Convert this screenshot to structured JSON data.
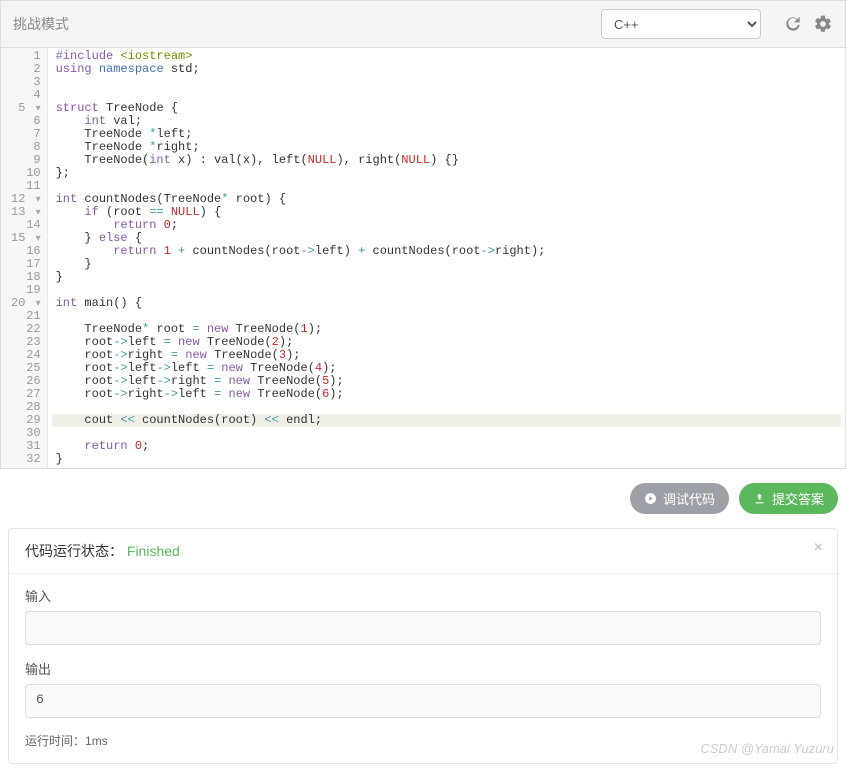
{
  "toolbar": {
    "title": "挑战模式",
    "language": "C++"
  },
  "code": {
    "lines": [
      {
        "n": 1,
        "fold": "",
        "tokens": [
          {
            "t": "#include ",
            "c": "kw"
          },
          {
            "t": "<iostream>",
            "c": "str"
          }
        ]
      },
      {
        "n": 2,
        "fold": "",
        "tokens": [
          {
            "t": "using ",
            "c": "kw"
          },
          {
            "t": "namespace ",
            "c": "ns"
          },
          {
            "t": "std;",
            "c": "ident"
          }
        ]
      },
      {
        "n": 3,
        "fold": "",
        "tokens": []
      },
      {
        "n": 4,
        "fold": "",
        "tokens": []
      },
      {
        "n": 5,
        "fold": "▾",
        "tokens": [
          {
            "t": "struct ",
            "c": "kw"
          },
          {
            "t": "TreeNode {",
            "c": "ident"
          }
        ]
      },
      {
        "n": 6,
        "fold": "",
        "tokens": [
          {
            "t": "    ",
            "c": ""
          },
          {
            "t": "int ",
            "c": "type"
          },
          {
            "t": "val;",
            "c": "ident"
          }
        ]
      },
      {
        "n": 7,
        "fold": "",
        "tokens": [
          {
            "t": "    TreeNode ",
            "c": "ident"
          },
          {
            "t": "*",
            "c": "op"
          },
          {
            "t": "left;",
            "c": "ident"
          }
        ]
      },
      {
        "n": 8,
        "fold": "",
        "tokens": [
          {
            "t": "    TreeNode ",
            "c": "ident"
          },
          {
            "t": "*",
            "c": "op"
          },
          {
            "t": "right;",
            "c": "ident"
          }
        ]
      },
      {
        "n": 9,
        "fold": "",
        "tokens": [
          {
            "t": "    TreeNode(",
            "c": "ident"
          },
          {
            "t": "int ",
            "c": "type"
          },
          {
            "t": "x) : val(x), left(",
            "c": "ident"
          },
          {
            "t": "NULL",
            "c": "const"
          },
          {
            "t": "), right(",
            "c": "ident"
          },
          {
            "t": "NULL",
            "c": "const"
          },
          {
            "t": ") {}",
            "c": "ident"
          }
        ]
      },
      {
        "n": 10,
        "fold": "",
        "tokens": [
          {
            "t": "};",
            "c": "ident"
          }
        ]
      },
      {
        "n": 11,
        "fold": "",
        "tokens": []
      },
      {
        "n": 12,
        "fold": "▾",
        "tokens": [
          {
            "t": "int ",
            "c": "type"
          },
          {
            "t": "countNodes(TreeNode",
            "c": "ident"
          },
          {
            "t": "* ",
            "c": "op"
          },
          {
            "t": "root) {",
            "c": "ident"
          }
        ]
      },
      {
        "n": 13,
        "fold": "▾",
        "tokens": [
          {
            "t": "    ",
            "c": ""
          },
          {
            "t": "if ",
            "c": "kw"
          },
          {
            "t": "(root ",
            "c": "ident"
          },
          {
            "t": "== ",
            "c": "op"
          },
          {
            "t": "NULL",
            "c": "const"
          },
          {
            "t": ") {",
            "c": "ident"
          }
        ]
      },
      {
        "n": 14,
        "fold": "",
        "tokens": [
          {
            "t": "        ",
            "c": ""
          },
          {
            "t": "return ",
            "c": "kw"
          },
          {
            "t": "0",
            "c": "num"
          },
          {
            "t": ";",
            "c": "ident"
          }
        ]
      },
      {
        "n": 15,
        "fold": "▾",
        "tokens": [
          {
            "t": "    } ",
            "c": "ident"
          },
          {
            "t": "else ",
            "c": "kw"
          },
          {
            "t": "{",
            "c": "ident"
          }
        ]
      },
      {
        "n": 16,
        "fold": "",
        "tokens": [
          {
            "t": "        ",
            "c": ""
          },
          {
            "t": "return ",
            "c": "kw"
          },
          {
            "t": "1",
            "c": "num"
          },
          {
            "t": " + ",
            "c": "op"
          },
          {
            "t": "countNodes(root",
            "c": "ident"
          },
          {
            "t": "->",
            "c": "op"
          },
          {
            "t": "left) ",
            "c": "ident"
          },
          {
            "t": "+ ",
            "c": "op"
          },
          {
            "t": "countNodes(root",
            "c": "ident"
          },
          {
            "t": "->",
            "c": "op"
          },
          {
            "t": "right);",
            "c": "ident"
          }
        ]
      },
      {
        "n": 17,
        "fold": "",
        "tokens": [
          {
            "t": "    }",
            "c": "ident"
          }
        ]
      },
      {
        "n": 18,
        "fold": "",
        "tokens": [
          {
            "t": "}",
            "c": "ident"
          }
        ]
      },
      {
        "n": 19,
        "fold": "",
        "tokens": []
      },
      {
        "n": 20,
        "fold": "▾",
        "tokens": [
          {
            "t": "int ",
            "c": "type"
          },
          {
            "t": "main() {",
            "c": "ident"
          }
        ]
      },
      {
        "n": 21,
        "fold": "",
        "tokens": []
      },
      {
        "n": 22,
        "fold": "",
        "tokens": [
          {
            "t": "    TreeNode",
            "c": "ident"
          },
          {
            "t": "* ",
            "c": "op"
          },
          {
            "t": "root ",
            "c": "ident"
          },
          {
            "t": "= ",
            "c": "op"
          },
          {
            "t": "new ",
            "c": "kw"
          },
          {
            "t": "TreeNode(",
            "c": "ident"
          },
          {
            "t": "1",
            "c": "num"
          },
          {
            "t": ");",
            "c": "ident"
          }
        ]
      },
      {
        "n": 23,
        "fold": "",
        "tokens": [
          {
            "t": "    root",
            "c": "ident"
          },
          {
            "t": "->",
            "c": "op"
          },
          {
            "t": "left ",
            "c": "ident"
          },
          {
            "t": "= ",
            "c": "op"
          },
          {
            "t": "new ",
            "c": "kw"
          },
          {
            "t": "TreeNode(",
            "c": "ident"
          },
          {
            "t": "2",
            "c": "num"
          },
          {
            "t": ");",
            "c": "ident"
          }
        ]
      },
      {
        "n": 24,
        "fold": "",
        "tokens": [
          {
            "t": "    root",
            "c": "ident"
          },
          {
            "t": "->",
            "c": "op"
          },
          {
            "t": "right ",
            "c": "ident"
          },
          {
            "t": "= ",
            "c": "op"
          },
          {
            "t": "new ",
            "c": "kw"
          },
          {
            "t": "TreeNode(",
            "c": "ident"
          },
          {
            "t": "3",
            "c": "num"
          },
          {
            "t": ");",
            "c": "ident"
          }
        ]
      },
      {
        "n": 25,
        "fold": "",
        "tokens": [
          {
            "t": "    root",
            "c": "ident"
          },
          {
            "t": "->",
            "c": "op"
          },
          {
            "t": "left",
            "c": "ident"
          },
          {
            "t": "->",
            "c": "op"
          },
          {
            "t": "left ",
            "c": "ident"
          },
          {
            "t": "= ",
            "c": "op"
          },
          {
            "t": "new ",
            "c": "kw"
          },
          {
            "t": "TreeNode(",
            "c": "ident"
          },
          {
            "t": "4",
            "c": "num"
          },
          {
            "t": ");",
            "c": "ident"
          }
        ]
      },
      {
        "n": 26,
        "fold": "",
        "tokens": [
          {
            "t": "    root",
            "c": "ident"
          },
          {
            "t": "->",
            "c": "op"
          },
          {
            "t": "left",
            "c": "ident"
          },
          {
            "t": "->",
            "c": "op"
          },
          {
            "t": "right ",
            "c": "ident"
          },
          {
            "t": "= ",
            "c": "op"
          },
          {
            "t": "new ",
            "c": "kw"
          },
          {
            "t": "TreeNode(",
            "c": "ident"
          },
          {
            "t": "5",
            "c": "num"
          },
          {
            "t": ");",
            "c": "ident"
          }
        ]
      },
      {
        "n": 27,
        "fold": "",
        "tokens": [
          {
            "t": "    root",
            "c": "ident"
          },
          {
            "t": "->",
            "c": "op"
          },
          {
            "t": "right",
            "c": "ident"
          },
          {
            "t": "->",
            "c": "op"
          },
          {
            "t": "left ",
            "c": "ident"
          },
          {
            "t": "= ",
            "c": "op"
          },
          {
            "t": "new ",
            "c": "kw"
          },
          {
            "t": "TreeNode(",
            "c": "ident"
          },
          {
            "t": "6",
            "c": "num"
          },
          {
            "t": ");",
            "c": "ident"
          }
        ]
      },
      {
        "n": 28,
        "fold": "",
        "tokens": []
      },
      {
        "n": 29,
        "fold": "",
        "hl": true,
        "tokens": [
          {
            "t": "    cout ",
            "c": "ident"
          },
          {
            "t": "<<",
            "c": "op"
          },
          {
            "t": " countNodes(root) ",
            "c": "ident"
          },
          {
            "t": "<< ",
            "c": "op"
          },
          {
            "t": "endl;",
            "c": "ident"
          }
        ]
      },
      {
        "n": 30,
        "fold": "",
        "tokens": []
      },
      {
        "n": 31,
        "fold": "",
        "tokens": [
          {
            "t": "    ",
            "c": ""
          },
          {
            "t": "return ",
            "c": "kw"
          },
          {
            "t": "0",
            "c": "num"
          },
          {
            "t": ";",
            "c": "ident"
          }
        ]
      },
      {
        "n": 32,
        "fold": "",
        "tokens": [
          {
            "t": "}",
            "c": "ident"
          }
        ]
      }
    ]
  },
  "actions": {
    "debug": "调试代码",
    "submit": "提交答案"
  },
  "result": {
    "status_label": "代码运行状态：",
    "status_value": "Finished",
    "input_label": "输入",
    "input_value": "",
    "output_label": "输出",
    "output_value": "6",
    "runtime_label": "运行时间：",
    "runtime_value": "1ms"
  },
  "watermark": "CSDN @Yamai Yuzuru"
}
